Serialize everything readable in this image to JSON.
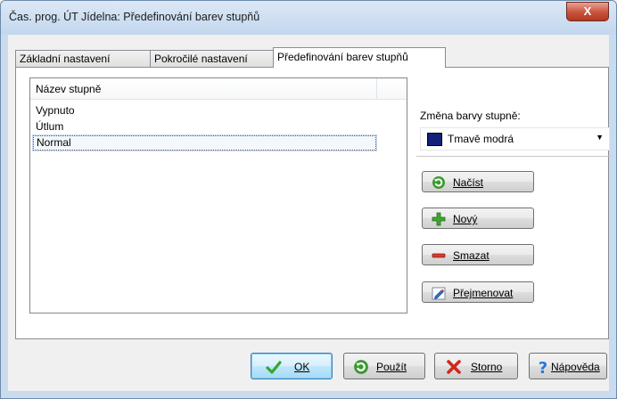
{
  "window": {
    "title": "Čas. prog. ÚT Jídelna: Předefinování barev stupňů",
    "close_label": "X"
  },
  "tabs": [
    {
      "label": "Základní nastavení"
    },
    {
      "label": "Pokročilé nastavení"
    },
    {
      "label": "Předefinování barev stupňů"
    }
  ],
  "list": {
    "header": "Název stupně",
    "items": [
      "Vypnuto",
      "Útlum",
      "Normal"
    ],
    "selected": "Normal"
  },
  "color": {
    "label": "Změna barvy stupně:",
    "selected_value": "Tmavě modrá",
    "swatch_color": "#13207a"
  },
  "side_buttons": {
    "load": "Načíst",
    "new": "Nový",
    "delete": "Smazat",
    "rename": "Přejmenovat"
  },
  "footer": {
    "ok": "OK",
    "apply": "Použít",
    "cancel": "Storno",
    "help": "Nápověda"
  }
}
